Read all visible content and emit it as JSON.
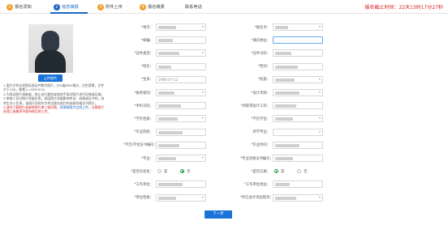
{
  "steps": [
    {
      "num": "1",
      "label": "报名须知"
    },
    {
      "num": "2",
      "label": "信息填报"
    },
    {
      "num": "3",
      "label": "附件上传"
    },
    {
      "num": "4",
      "label": "报名缴费"
    }
  ],
  "contact": "联系电话",
  "deadline": "报名截止时间：22天13时17分27秒",
  "upload_label": "上传照片",
  "notes": {
    "n1": "1.照片文件必须是标准证件数字照片，JPG或JPEG格式，白色背景，文件大于10K，像素>=295*413。",
    "n2": "2.为保证照片清晰度，禁止自行裁剪或其他手段对照片进行拉伸或压缩。",
    "n3": "3.审查人员对照片质量负责，如因照片质量影响考试、成绩或证书的，由考生本人负责，该照片同时作为考试报名照片和成绩合格证书照片。",
    "n4_red": "4.请勿下载照片或者将照片做三级切割，",
    "n4_blue": "即需按照片比例上传，",
    "n4_red2": "注意照片处理工具集序列保持原比例上传。"
  },
  "left_fields": [
    {
      "label": "地市：",
      "required": true,
      "type": "select",
      "value": ""
    },
    {
      "label": "邮编：",
      "required": true,
      "type": "text",
      "value": ""
    },
    {
      "label": "证件类型：",
      "required": true,
      "type": "select",
      "value": ""
    },
    {
      "label": "姓名：",
      "required": true,
      "type": "text",
      "value": ""
    },
    {
      "label": "生日：",
      "required": true,
      "type": "text",
      "value": "1995-07-12"
    },
    {
      "label": "报考级别：",
      "required": true,
      "type": "select",
      "value": ""
    },
    {
      "label": "手机号码：",
      "required": true,
      "type": "text",
      "value": ""
    },
    {
      "label": "学历性质：",
      "required": true,
      "type": "select",
      "value": ""
    },
    {
      "label": "毕业院校：",
      "required": true,
      "type": "text",
      "value": ""
    },
    {
      "label": "学历/学位证书编号：",
      "required": true,
      "type": "text",
      "value": ""
    },
    {
      "label": "专业：",
      "required": true,
      "type": "select",
      "value": ""
    },
    {
      "label": "是否在校生：",
      "required": true,
      "type": "radio",
      "options": [
        "是",
        "否"
      ],
      "selected": 1
    },
    {
      "label": "工作单位：",
      "required": true,
      "type": "text",
      "value": ""
    },
    {
      "label": "单位性质：",
      "required": true,
      "type": "select",
      "value": ""
    }
  ],
  "right_fields": [
    {
      "label": "报名点：",
      "required": true,
      "type": "select",
      "value": ""
    },
    {
      "label": "通讯地址：",
      "required": true,
      "type": "text",
      "value": ""
    },
    {
      "label": "证件号码：",
      "required": true,
      "type": "text",
      "value": ""
    },
    {
      "label": "性别：",
      "required": true,
      "type": "text",
      "value": ""
    },
    {
      "label": "民族：",
      "required": true,
      "type": "select",
      "value": ""
    },
    {
      "label": "会计年限：",
      "required": true,
      "type": "select",
      "value": ""
    },
    {
      "label": "所取得会计工作：",
      "required": true,
      "type": "text",
      "value": ""
    },
    {
      "label": "学历学位：",
      "required": true,
      "type": "select",
      "value": ""
    },
    {
      "label": "所学专业：",
      "required": false,
      "type": "select",
      "value": ""
    },
    {
      "label": "毕业时间：",
      "required": true,
      "type": "text",
      "value": ""
    },
    {
      "label": "专业资格证书编号：",
      "required": true,
      "type": "text",
      "value": ""
    },
    {
      "label": "是否已离：",
      "required": true,
      "type": "radio",
      "options": [
        "是",
        "否"
      ],
      "selected": 0
    },
    {
      "label": "工作单位地址：",
      "required": true,
      "type": "text",
      "value": ""
    },
    {
      "label": "所在会计岗位职务：",
      "required": true,
      "type": "select",
      "value": ""
    }
  ],
  "next_label": "下一步",
  "colors": {
    "accent": "#1a73d9",
    "warning": "#d62020",
    "step_pending": "#f0a030"
  }
}
